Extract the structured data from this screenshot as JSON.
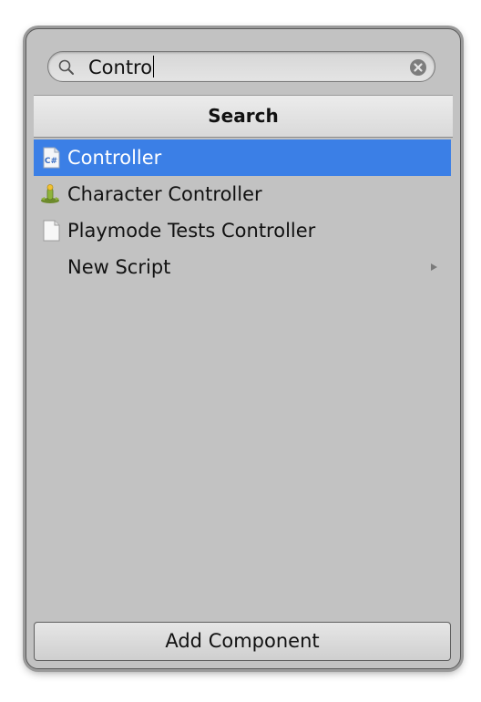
{
  "search": {
    "value": "Contro",
    "icon": "search-icon",
    "clear_icon": "clear-icon"
  },
  "header": {
    "title": "Search"
  },
  "results": [
    {
      "label": "Controller",
      "icon": "csharp-script-icon",
      "selected": true
    },
    {
      "label": "Character Controller",
      "icon": "character-controller-icon",
      "selected": false
    },
    {
      "label": "Playmode Tests Controller",
      "icon": "document-icon",
      "selected": false
    },
    {
      "label": "New Script",
      "icon": "submenu-arrow-icon",
      "selected": false
    }
  ],
  "footer": {
    "add_component_label": "Add Component"
  },
  "colors": {
    "selection": "#3b7fe6",
    "panel_background": "#c2c2c2",
    "header_background": "#e3e3e3"
  }
}
